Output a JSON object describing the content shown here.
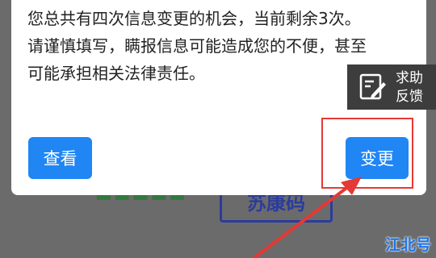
{
  "background": {
    "green_text": "■■■■■",
    "stamp_text": "苏康码"
  },
  "dialog": {
    "message_lines": [
      "您总共有四次信息变更的机会，当前剩余3次。",
      "请谨慎填写，瞒报信息可能造成您的不便，甚至",
      "可能承担相关法律责任。"
    ],
    "view_button": "查看",
    "change_button": "变更"
  },
  "help": {
    "icon": "edit-note-icon",
    "label_line1": "求助",
    "label_line2": "反馈"
  },
  "watermark": "江北号",
  "colors": {
    "primary_button": "#1f86f4",
    "annotation_red": "#e53935",
    "help_panel": "#3d3d3d"
  }
}
